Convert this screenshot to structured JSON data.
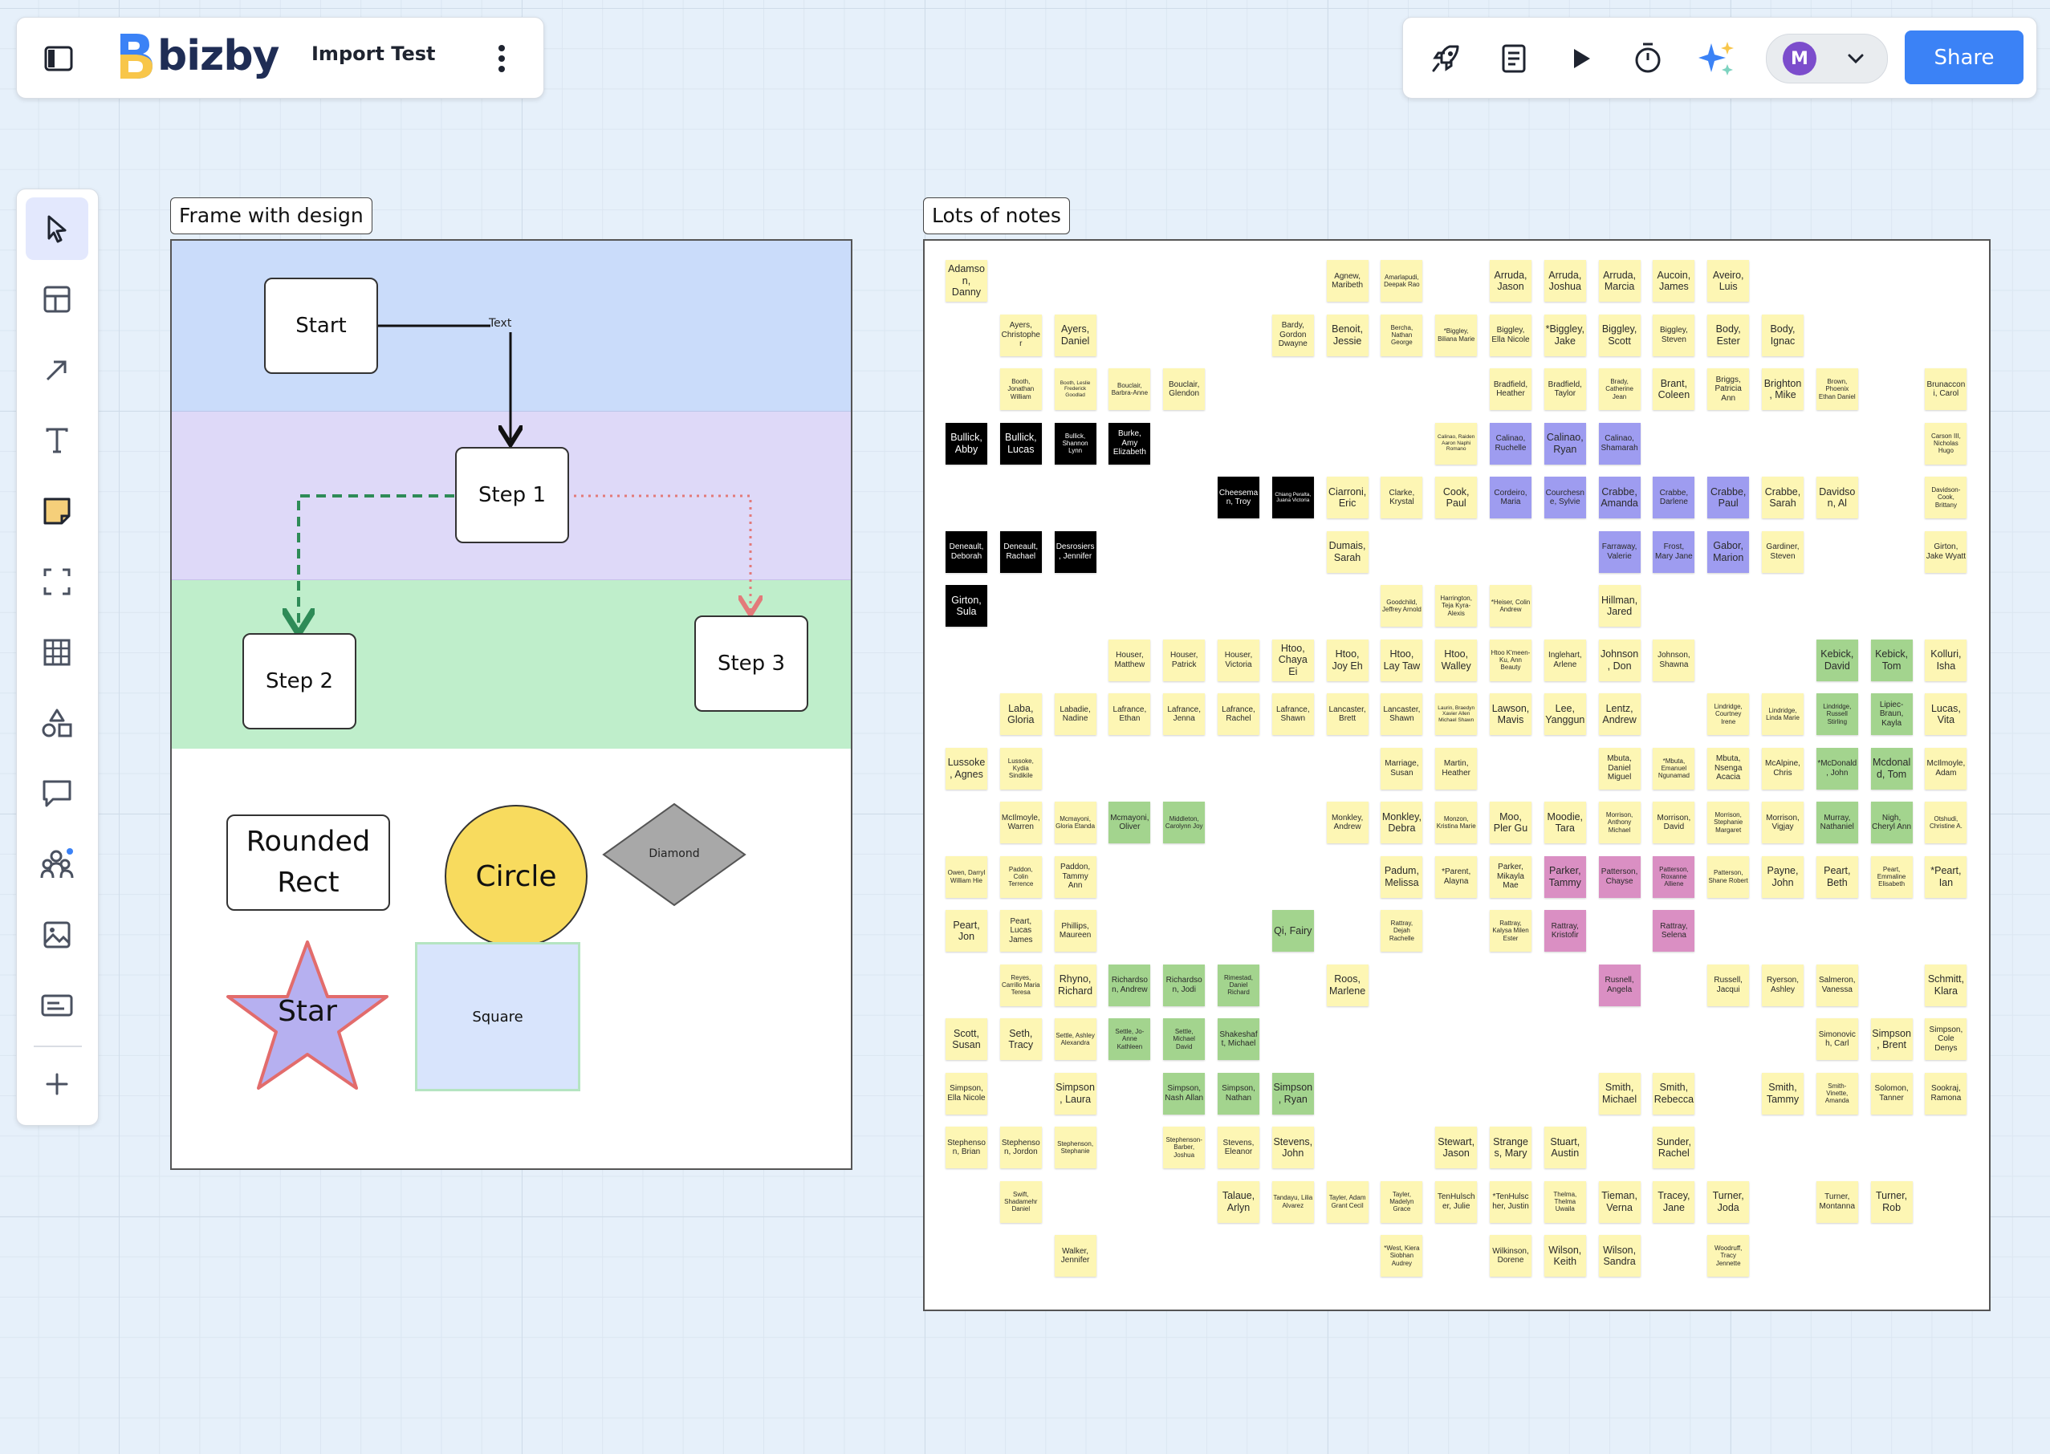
{
  "app": {
    "logo_text": "bizby",
    "doc_title": "Import Test"
  },
  "header_right": {
    "avatar_initial": "M",
    "share_label": "Share"
  },
  "icons": {
    "sidebar_toggle": "sidebar-toggle-icon",
    "menu": "more-vertical-icon",
    "rocket": "rocket-icon",
    "notes": "document-icon",
    "present": "play-icon",
    "timer": "stopwatch-icon",
    "ai": "sparkles-icon",
    "dropdown": "chevron-down-icon"
  },
  "tools": [
    "select",
    "template",
    "arrow",
    "text",
    "sticky-note",
    "frame",
    "table",
    "shapes",
    "comment",
    "collaborators",
    "image",
    "card",
    "add"
  ],
  "frame1": {
    "label": "Frame with design",
    "start": "Start",
    "connector_text": "Text",
    "step1": "Step 1",
    "step2": "Step 2",
    "step3": "Step 3",
    "rounded_rect": "Rounded Rect",
    "circle": "Circle",
    "diamond": "Diamond",
    "star": "Star",
    "square": "Square",
    "lane_colors": [
      "#cadcfa",
      "#ded9f8",
      "#bfeecb"
    ],
    "circle_color": "#f8db5e",
    "star_color": "#b6b0f0",
    "square_color": "#d8e4fc",
    "diamond_color": "#a8a8a8"
  },
  "frame2": {
    "label": "Lots of notes",
    "colors": {
      "y": "#fdf6b4",
      "b": "#000000",
      "p": "#9e9cf0",
      "g": "#a3d48e",
      "m": "#da8fc3"
    },
    "rows": [
      [
        [
          0,
          "Adamson, Danny",
          "y"
        ],
        [
          7,
          "Agnew, Maribeth",
          "y"
        ],
        [
          8,
          "Amarlapudi, Deepak Rao",
          "y"
        ],
        [
          10,
          "Arruda, Jason",
          "y"
        ],
        [
          11,
          "Arruda, Joshua",
          "y"
        ],
        [
          12,
          "Arruda, Marcia",
          "y"
        ],
        [
          13,
          "Aucoin, James",
          "y"
        ],
        [
          14,
          "Aveiro, Luis",
          "y"
        ]
      ],
      [
        [
          1,
          "Ayers, Christopher",
          "y"
        ],
        [
          2,
          "Ayers, Daniel",
          "y"
        ],
        [
          6,
          "Bardy, Gordon Dwayne",
          "y"
        ],
        [
          7,
          "Benoit, Jessie",
          "y"
        ],
        [
          8,
          "Bercha, Nathan George",
          "y"
        ],
        [
          9,
          "*Biggley, Biliana Marie",
          "y"
        ],
        [
          10,
          "Biggley, Ella Nicole",
          "y"
        ],
        [
          11,
          "*Biggley, Jake",
          "y"
        ],
        [
          12,
          "Biggley, Scott",
          "y"
        ],
        [
          13,
          "Biggley, Steven",
          "y"
        ],
        [
          14,
          "Body, Ester",
          "y"
        ],
        [
          15,
          "Body, Ignac",
          "y"
        ]
      ],
      [
        [
          1,
          "Booth, Jonathan William",
          "y"
        ],
        [
          2,
          "Booth, Leslie Frederick Goodlad",
          "y"
        ],
        [
          3,
          "Bouclair, Barbra-Anne",
          "y"
        ],
        [
          4,
          "Bouclair, Glendon",
          "y"
        ],
        [
          10,
          "Bradfield, Heather",
          "y"
        ],
        [
          11,
          "Bradfield, Taylor",
          "y"
        ],
        [
          12,
          "Brady, Catherine Jean",
          "y"
        ],
        [
          13,
          "Brant, Coleen",
          "y"
        ],
        [
          14,
          "Briggs, Patricia Ann",
          "y"
        ],
        [
          15,
          "Brighton, Mike",
          "y"
        ],
        [
          16,
          "Brown, Phoenix Ethan Daniel",
          "y"
        ],
        [
          18,
          "Brunacconi, Carol",
          "y"
        ]
      ],
      [
        [
          0,
          "Bullick, Abby",
          "b"
        ],
        [
          1,
          "Bullick, Lucas",
          "b"
        ],
        [
          2,
          "Bullick, Shannon Lynn",
          "b"
        ],
        [
          3,
          "Burke, Amy Elizabeth",
          "b"
        ],
        [
          9,
          "Calinao, Raiden Aaron Naphi Romano",
          "y"
        ],
        [
          10,
          "Calinao, Ruchelle",
          "p"
        ],
        [
          11,
          "Calinao, Ryan",
          "p"
        ],
        [
          12,
          "Calinao, Shamarah",
          "p"
        ],
        [
          18,
          "Carson III, Nicholas Hugo",
          "y"
        ]
      ],
      [
        [
          5,
          "Cheeseman, Troy",
          "b"
        ],
        [
          6,
          "Chiang Peralta, Juana Victoria",
          "b"
        ],
        [
          7,
          "Ciarroni, Eric",
          "y"
        ],
        [
          8,
          "Clarke, Krystal",
          "y"
        ],
        [
          9,
          "Cook, Paul",
          "y"
        ],
        [
          10,
          "Cordeiro, Maria",
          "p"
        ],
        [
          11,
          "Courchesne, Sylvie",
          "p"
        ],
        [
          12,
          "Crabbe, Amanda",
          "p"
        ],
        [
          13,
          "Crabbe, Darlene",
          "p"
        ],
        [
          14,
          "Crabbe, Paul",
          "p"
        ],
        [
          15,
          "Crabbe, Sarah",
          "y"
        ],
        [
          16,
          "Davidson, Al",
          "y"
        ],
        [
          18,
          "Davidson-Cook, Brittany",
          "y"
        ]
      ],
      [
        [
          0,
          "Deneault, Deborah",
          "b"
        ],
        [
          1,
          "Deneault, Rachael",
          "b"
        ],
        [
          2,
          "Desrosiers, Jennifer",
          "b"
        ],
        [
          7,
          "Dumais, Sarah",
          "y"
        ],
        [
          12,
          "Farraway, Valerie",
          "p"
        ],
        [
          13,
          "Frost, Mary Jane",
          "p"
        ],
        [
          14,
          "Gabor, Marion",
          "p"
        ],
        [
          15,
          "Gardiner, Steven",
          "y"
        ],
        [
          18,
          "Girton, Jake Wyatt",
          "y"
        ]
      ],
      [
        [
          0,
          "Girton, Sula",
          "b"
        ],
        [
          8,
          "Goodchild, Jeffrey Arnold",
          "y"
        ],
        [
          9,
          "Harrington, Teja Kyra-Alexis",
          "y"
        ],
        [
          10,
          "*Heiser, Colin Andrew",
          "y"
        ],
        [
          12,
          "Hillman, Jared",
          "y"
        ]
      ],
      [
        [
          3,
          "Houser, Matthew",
          "y"
        ],
        [
          4,
          "Houser, Patrick",
          "y"
        ],
        [
          5,
          "Houser, Victoria",
          "y"
        ],
        [
          6,
          "Htoo, Chaya Ei",
          "y"
        ],
        [
          7,
          "Htoo, Joy Eh",
          "y"
        ],
        [
          8,
          "Htoo, Lay Taw",
          "y"
        ],
        [
          9,
          "Htoo, Walley",
          "y"
        ],
        [
          10,
          "Htoo K'meen-Ku, Ann Beauty",
          "y"
        ],
        [
          11,
          "Inglehart, Arlene",
          "y"
        ],
        [
          12,
          "Johnson, Don",
          "y"
        ],
        [
          13,
          "Johnson, Shawna",
          "y"
        ],
        [
          16,
          "Kebick, David",
          "g"
        ],
        [
          17,
          "Kebick, Tom",
          "g"
        ],
        [
          18,
          "Kolluri, Isha",
          "y"
        ]
      ],
      [
        [
          1,
          "Laba, Gloria",
          "y"
        ],
        [
          2,
          "Labadie, Nadine",
          "y"
        ],
        [
          3,
          "Lafrance, Ethan",
          "y"
        ],
        [
          4,
          "Lafrance, Jenna",
          "y"
        ],
        [
          5,
          "Lafrance, Rachel",
          "y"
        ],
        [
          6,
          "Lafrance, Shawn",
          "y"
        ],
        [
          7,
          "Lancaster, Brett",
          "y"
        ],
        [
          8,
          "Lancaster, Shawn",
          "y"
        ],
        [
          9,
          "Laurin, Braedyn Xavier Allen Michael Shawn",
          "y"
        ],
        [
          10,
          "Lawson, Mavis",
          "y"
        ],
        [
          11,
          "Lee, Yanggun",
          "y"
        ],
        [
          12,
          "Lentz, Andrew",
          "y"
        ],
        [
          14,
          "Lindridge, Courtney Irene",
          "y"
        ],
        [
          15,
          "Lindridge, Linda Marie",
          "y"
        ],
        [
          16,
          "Lindridge, Russell Stirling",
          "g"
        ],
        [
          17,
          "Lipiec-Braun, Kayla",
          "g"
        ],
        [
          18,
          "Lucas, Vita",
          "y"
        ]
      ],
      [
        [
          0,
          "Lussoke, Agnes",
          "y"
        ],
        [
          1,
          "Lussoke, Kydia Sindikile",
          "y"
        ],
        [
          8,
          "Marriage, Susan",
          "y"
        ],
        [
          9,
          "Martin, Heather",
          "y"
        ],
        [
          12,
          "Mbuta, Daniel Miguel",
          "y"
        ],
        [
          13,
          "*Mbuta, Emanuel Ngunamad",
          "y"
        ],
        [
          14,
          "Mbuta, Nsenga Acacia",
          "y"
        ],
        [
          15,
          "McAlpine, Chris",
          "y"
        ],
        [
          16,
          "*McDonald, John",
          "g"
        ],
        [
          17,
          "Mcdonald, Tom",
          "g"
        ],
        [
          18,
          "McIlmoyle, Adam",
          "y"
        ]
      ],
      [
        [
          1,
          "McIlmoyle, Warren",
          "y"
        ],
        [
          2,
          "Mcmayoni, Gloria Etanda",
          "y"
        ],
        [
          3,
          "Mcmayoni, Oliver",
          "g"
        ],
        [
          4,
          "Middleton, Carolynn Joy",
          "g"
        ],
        [
          7,
          "Monkley, Andrew",
          "y"
        ],
        [
          8,
          "Monkley, Debra",
          "y"
        ],
        [
          9,
          "Monzon, Kristina Marie",
          "y"
        ],
        [
          10,
          "Moo, Pler Gu",
          "y"
        ],
        [
          11,
          "Moodie, Tara",
          "y"
        ],
        [
          12,
          "Morrison, Anthony Michael",
          "y"
        ],
        [
          13,
          "Morrison, David",
          "y"
        ],
        [
          14,
          "Morrison, Stephanie Margaret",
          "y"
        ],
        [
          15,
          "Morrison, Vigjay",
          "y"
        ],
        [
          16,
          "Murray, Nathaniel",
          "g"
        ],
        [
          17,
          "Nigh, Cheryl Ann",
          "g"
        ],
        [
          18,
          "Otshudi, Christine A.",
          "y"
        ]
      ],
      [
        [
          0,
          "Owen, Darryl William Hie",
          "y"
        ],
        [
          1,
          "Paddon, Colin Terrence",
          "y"
        ],
        [
          2,
          "Paddon, Tammy Ann",
          "y"
        ],
        [
          8,
          "Padum, Melissa",
          "y"
        ],
        [
          9,
          "*Parent, Alayna",
          "y"
        ],
        [
          10,
          "Parker, Mikayla Mae",
          "y"
        ],
        [
          11,
          "Parker, Tammy",
          "m"
        ],
        [
          12,
          "Patterson, Chayse",
          "m"
        ],
        [
          13,
          "Patterson, Roxanne Alliene",
          "m"
        ],
        [
          14,
          "Patterson, Shane Robert",
          "y"
        ],
        [
          15,
          "Payne, John",
          "y"
        ],
        [
          16,
          "Peart, Beth",
          "y"
        ],
        [
          17,
          "Peart, Emmaline Elisabeth",
          "y"
        ],
        [
          18,
          "*Peart, Ian",
          "y"
        ]
      ],
      [
        [
          0,
          "Peart, Jon",
          "y"
        ],
        [
          1,
          "Peart, Lucas James",
          "y"
        ],
        [
          2,
          "Phillips, Maureen",
          "y"
        ],
        [
          6,
          "Qi, Fairy",
          "g"
        ],
        [
          8,
          "Rattray, Dejah Rachelle",
          "y"
        ],
        [
          10,
          "Rattray, Kalysa Milen Ester",
          "y"
        ],
        [
          11,
          "Rattray, Kristofir",
          "m"
        ],
        [
          13,
          "Rattray, Selena",
          "m"
        ]
      ],
      [
        [
          1,
          "Reyes, Carrillo Maria Teresa",
          "y"
        ],
        [
          2,
          "Rhyno, Richard",
          "y"
        ],
        [
          3,
          "Richardson, Andrew",
          "g"
        ],
        [
          4,
          "Richardson, Jodi",
          "g"
        ],
        [
          5,
          "Rimestad, Daniel Richard",
          "g"
        ],
        [
          7,
          "Roos, Marlene",
          "y"
        ],
        [
          12,
          "Rusnell, Angela",
          "m"
        ],
        [
          14,
          "Russell, Jacqui",
          "y"
        ],
        [
          15,
          "Ryerson, Ashley",
          "y"
        ],
        [
          16,
          "Salmeron, Vanessa",
          "y"
        ],
        [
          18,
          "Schmitt, Klara",
          "y"
        ]
      ],
      [
        [
          0,
          "Scott, Susan",
          "y"
        ],
        [
          1,
          "Seth, Tracy",
          "y"
        ],
        [
          2,
          "Settle, Ashley Alexandra",
          "y"
        ],
        [
          3,
          "Settle, Jo-Anne Kathleen",
          "g"
        ],
        [
          4,
          "Settle, Michael David",
          "g"
        ],
        [
          5,
          "Shakeshaft, Michael",
          "g"
        ],
        [
          16,
          "Simonovich, Carl",
          "y"
        ],
        [
          17,
          "Simpson, Brent",
          "y"
        ],
        [
          18,
          "Simpson, Cole Denys",
          "y"
        ]
      ],
      [
        [
          0,
          "Simpson, Ella Nicole",
          "y"
        ],
        [
          2,
          "Simpson, Laura",
          "y"
        ],
        [
          4,
          "Simpson, Nash Allan",
          "g"
        ],
        [
          5,
          "Simpson, Nathan",
          "g"
        ],
        [
          6,
          "Simpson, Ryan",
          "g"
        ],
        [
          12,
          "Smith, Michael",
          "y"
        ],
        [
          13,
          "Smith, Rebecca",
          "y"
        ],
        [
          15,
          "Smith, Tammy",
          "y"
        ],
        [
          16,
          "Smith-Vinette, Amanda",
          "y"
        ],
        [
          17,
          "Solomon, Tanner",
          "y"
        ],
        [
          18,
          "Sookraj, Ramona",
          "y"
        ]
      ],
      [
        [
          0,
          "Stephenson, Brian",
          "y"
        ],
        [
          1,
          "Stephenson, Jordon",
          "y"
        ],
        [
          2,
          "Stephenson, Stephanie",
          "y"
        ],
        [
          4,
          "Stephenson-Barber, Joshua",
          "y"
        ],
        [
          5,
          "Stevens, Eleanor",
          "y"
        ],
        [
          6,
          "Stevens, John",
          "y"
        ],
        [
          9,
          "Stewart, Jason",
          "y"
        ],
        [
          10,
          "Stranges, Mary",
          "y"
        ],
        [
          11,
          "Stuart, Austin",
          "y"
        ],
        [
          13,
          "Sunder, Rachel",
          "y"
        ]
      ],
      [
        [
          1,
          "Swift, Shadamehr Daniel",
          "y"
        ],
        [
          5,
          "Talaue, Arlyn",
          "y"
        ],
        [
          6,
          "Tandayu, Lilia Alvarez",
          "y"
        ],
        [
          7,
          "Tayler, Adam Grant Cecil",
          "y"
        ],
        [
          8,
          "Tayler, Madelyn Grace",
          "y"
        ],
        [
          9,
          "TenHulscher, Julie",
          "y"
        ],
        [
          10,
          "*TenHulscher, Justin",
          "y"
        ],
        [
          11,
          "Thelma, Thelma Uwaila",
          "y"
        ],
        [
          12,
          "Tieman, Verna",
          "y"
        ],
        [
          13,
          "Tracey, Jane",
          "y"
        ],
        [
          14,
          "Turner, Joda",
          "y"
        ],
        [
          16,
          "Turner, Montanna",
          "y"
        ],
        [
          17,
          "Turner, Rob",
          "y"
        ]
      ],
      [
        [
          2,
          "Walker, Jennifer",
          "y"
        ],
        [
          8,
          "*West, Kiera Siobhan Audrey",
          "y"
        ],
        [
          10,
          "Wilkinson, Dorene",
          "y"
        ],
        [
          11,
          "Wilson, Keith",
          "y"
        ],
        [
          12,
          "Wilson, Sandra",
          "y"
        ],
        [
          14,
          "Woodruff, Tracy Jennette",
          "y"
        ]
      ]
    ]
  }
}
